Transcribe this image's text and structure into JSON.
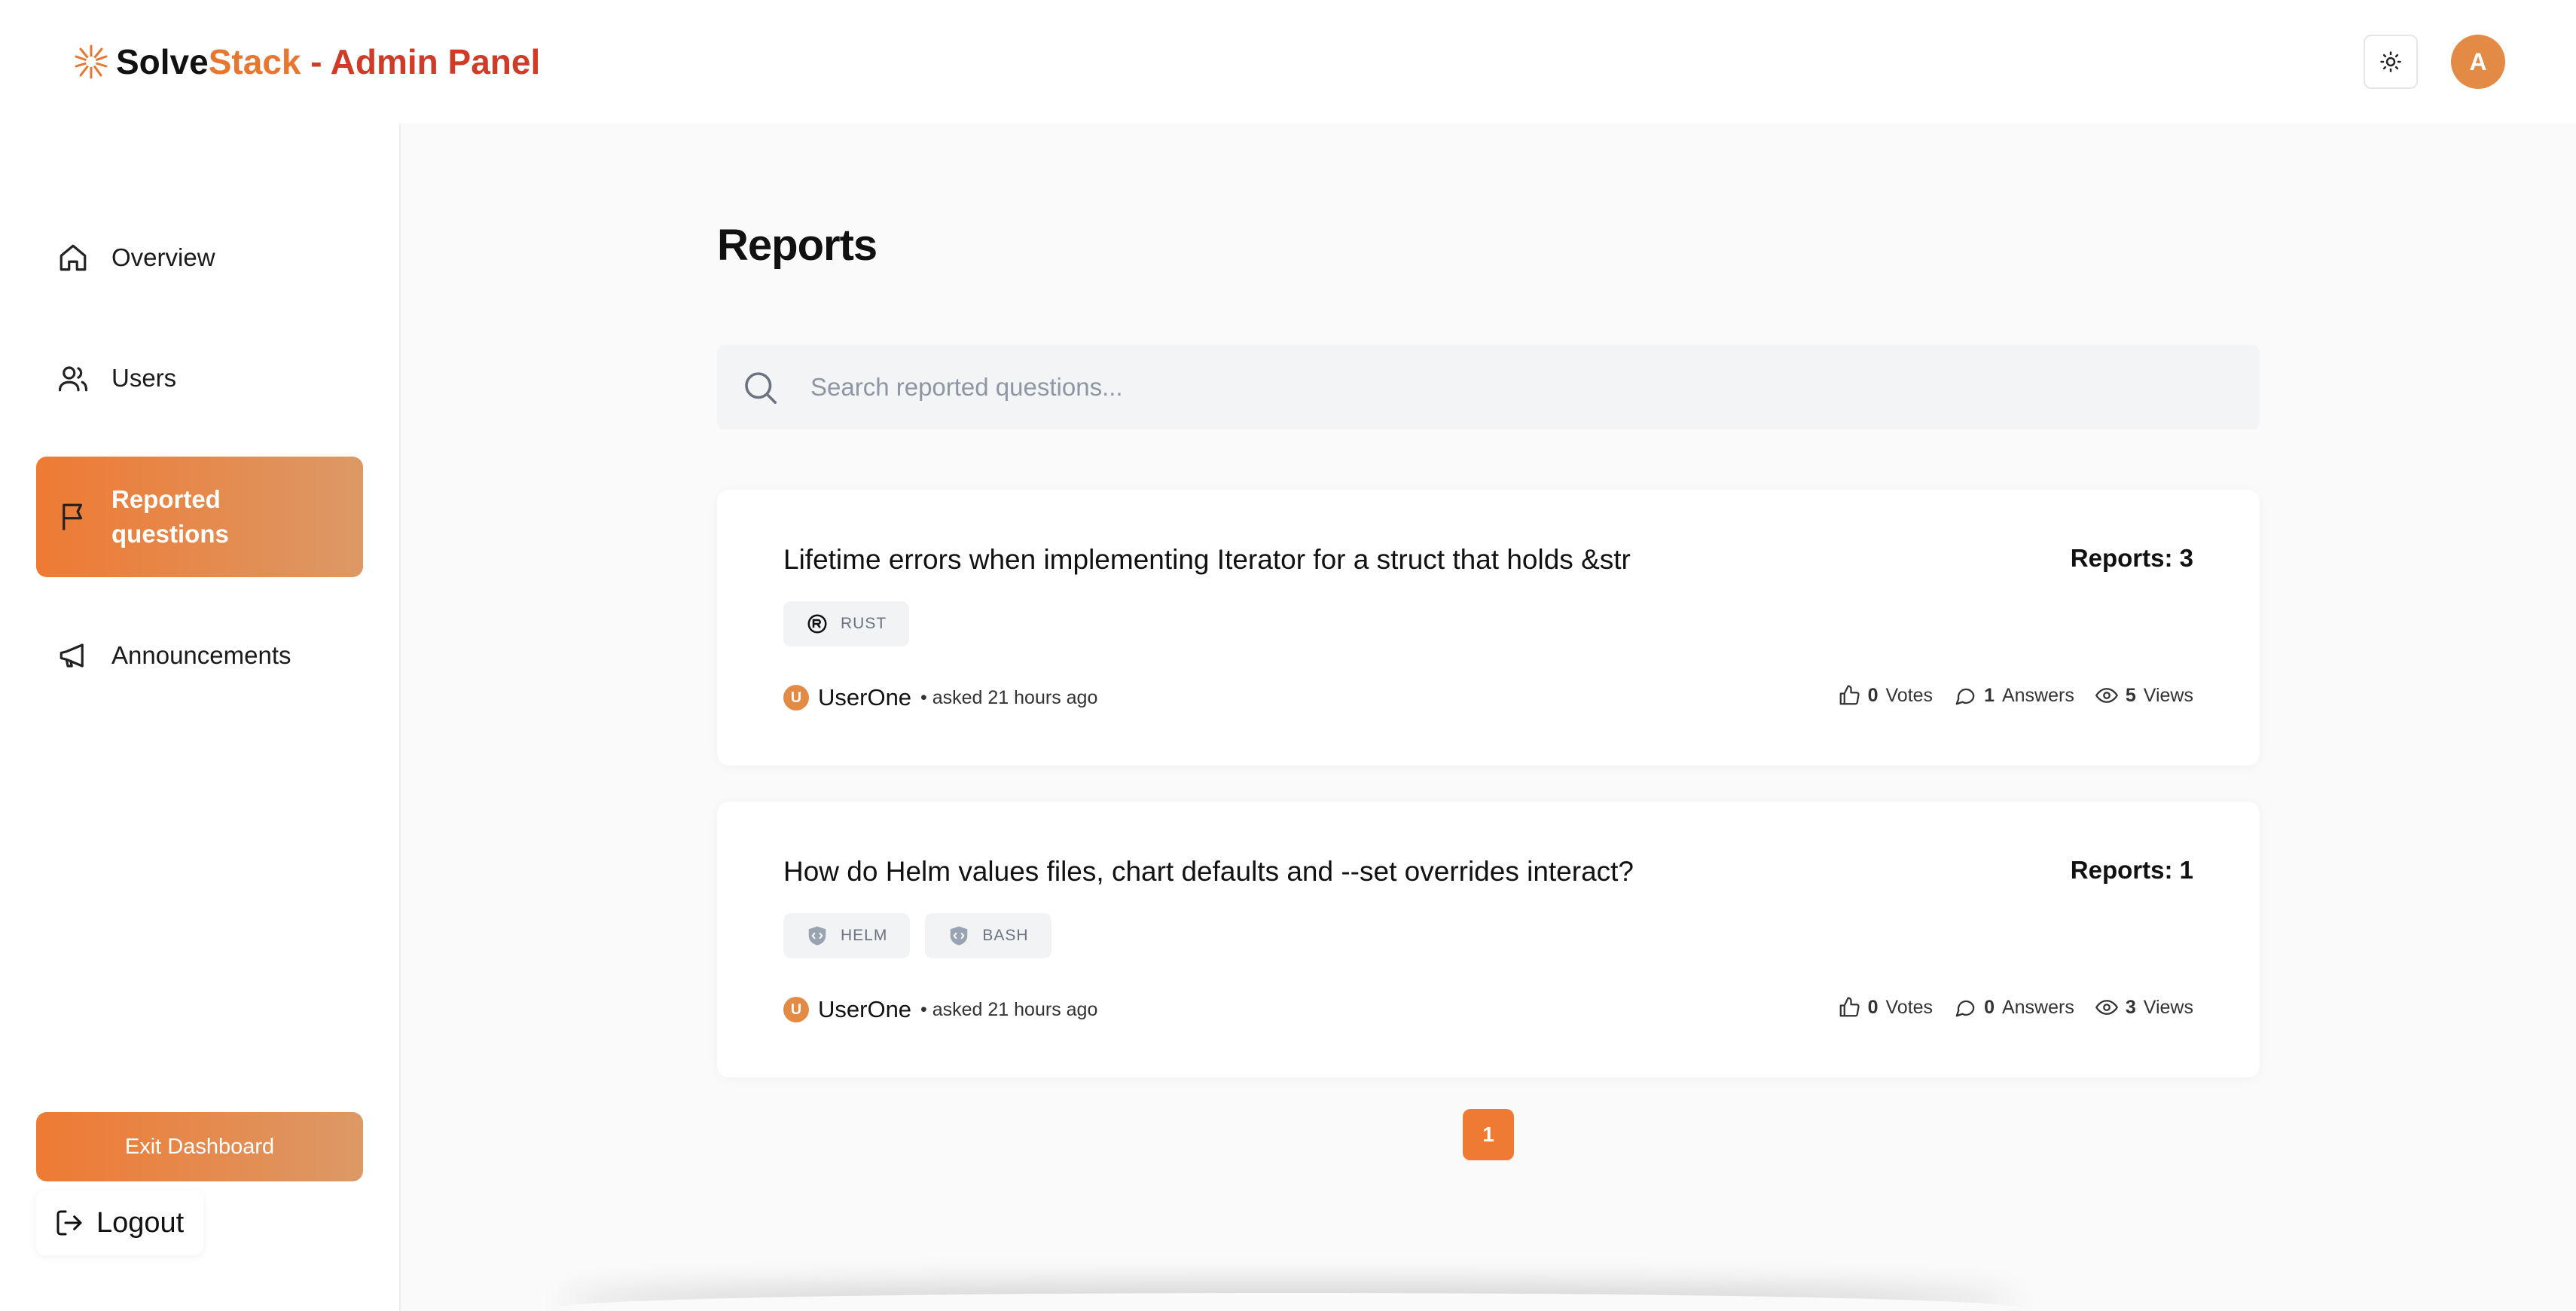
{
  "brand": {
    "part1": "Solve",
    "part2": "Stack",
    "part3": " - Admin Panel"
  },
  "header": {
    "avatar_letter": "A"
  },
  "sidebar": {
    "items": [
      {
        "label": "Overview",
        "icon": "home-icon"
      },
      {
        "label": "Users",
        "icon": "users-icon"
      },
      {
        "label": "Reported questions",
        "icon": "flag-icon",
        "active": true
      },
      {
        "label": "Announcements",
        "icon": "megaphone-icon"
      }
    ],
    "exit_label": "Exit Dashboard",
    "logout_label": "Logout"
  },
  "main": {
    "title": "Reports",
    "search": {
      "placeholder": "Search reported questions..."
    },
    "cards": [
      {
        "title": "Lifetime errors when implementing Iterator for a struct that holds &str",
        "reports": "Reports: 3",
        "tags": [
          "RUST"
        ],
        "user": "UserOne",
        "user_initial": "U",
        "asked": "• asked 21 hours ago",
        "votes_num": "0",
        "votes_label": "Votes",
        "answers_num": "1",
        "answers_label": "Answers",
        "views_num": "5",
        "views_label": "Views"
      },
      {
        "title": "How do Helm values files, chart defaults and --set overrides interact?",
        "reports": "Reports: 1",
        "tags": [
          "HELM",
          "BASH"
        ],
        "user": "UserOne",
        "user_initial": "U",
        "asked": "• asked 21 hours ago",
        "votes_num": "0",
        "votes_label": "Votes",
        "answers_num": "0",
        "answers_label": "Answers",
        "views_num": "3",
        "views_label": "Views"
      }
    ],
    "page": "1"
  },
  "colors": {
    "accent": "#ee7a33",
    "brand_red": "#cf3b26"
  }
}
